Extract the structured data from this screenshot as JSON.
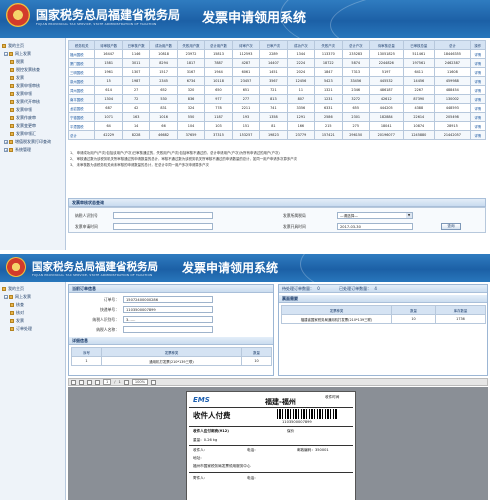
{
  "shot1": {
    "banner": {
      "title_cn": "国家税务总局福建省税务局",
      "title_en": "FUJIAN PROVINCIAL TAX SERVICE, STATE ADMINISTRATION OF TAXATION",
      "system": "发票申请领用系统"
    },
    "tree": [
      "我的主页",
      "网上发票",
      "税票",
      "税控发票核查",
      "发票",
      "发票申领审核",
      "发票申领",
      "发票代开审核",
      "发票申领",
      "发票作废审",
      "发票变更审",
      "发票申领汇",
      "增值税发票打印查询",
      "系统管理"
    ],
    "table": {
      "headers": [
        "税务机关",
        "待审核户数",
        "已审核户数",
        "成功用户数",
        "失败用户数",
        "总计用户数",
        "待审户次",
        "已审户次",
        "成功户次",
        "失败户次",
        "总计户次",
        "待审核总量",
        "已审核总量",
        "总计",
        "操作"
      ],
      "rows": [
        [
          "福州国税",
          "16447",
          "1146",
          "10818",
          "23972",
          "15813",
          "112593",
          "2289",
          "1344",
          "113370",
          "235283",
          "13051825",
          "511461",
          "18446355",
          "详情"
        ],
        [
          "厦门国税",
          "1581",
          "3011",
          "8294",
          "1817",
          "7887",
          "4287",
          "14407",
          "2224",
          "18722",
          "5874",
          "2244826",
          "197561",
          "2462387",
          "详情"
        ],
        [
          "三明国税",
          "1961",
          "1307",
          "1517",
          "3167",
          "1944",
          "6061",
          "1451",
          "2024",
          "1847",
          "7313",
          "5197",
          "6411",
          "11608",
          "详情"
        ],
        [
          "泉州国税",
          "15",
          "1987",
          "2345",
          "6734",
          "10118",
          "23457",
          "3567",
          "12456",
          "5423",
          "33456",
          "445532",
          "14456",
          "459988",
          "详情"
        ],
        [
          "漳州国税",
          "614",
          "27",
          "652",
          "320",
          "650",
          "651",
          "721",
          "11",
          "1321",
          "2346",
          "486187",
          "2267",
          "488454",
          "详情"
        ],
        [
          "南平国税",
          "1304",
          "72",
          "530",
          "836",
          "977",
          "277",
          "813",
          "807",
          "1231",
          "3272",
          "42612",
          "87390",
          "130002",
          "详情"
        ],
        [
          "龙岩国税",
          "687",
          "42",
          "831",
          "324",
          "778",
          "2211",
          "741",
          "3356",
          "6331",
          "655",
          "444205",
          "4388",
          "448593",
          "详情"
        ],
        [
          "宁德国税",
          "1071",
          "163",
          "1016",
          "550",
          "1187",
          "193",
          "1358",
          "1291",
          "2586",
          "2301",
          "182884",
          "22614",
          "205498",
          "详情"
        ],
        [
          "平潭国税",
          "64",
          "14",
          "66",
          "104",
          "103",
          "151",
          "81",
          "166",
          "215",
          "275",
          "18041",
          "10874",
          "28915",
          "详情"
        ],
        [
          "总计",
          "42229",
          "8228",
          "46682",
          "37659",
          "37315",
          "153257",
          "19823",
          "23779",
          "157421",
          "296150",
          "20196077",
          "1245880",
          "21442057",
          "详情"
        ]
      ]
    },
    "notes": [
      "1、 申请成功用户(户次)包括该用户(户次)已审核通过的，失败用户(户次)包括审核不通过的，总计申请用户(户次)为所有申请过的用户(户次)",
      "2、 审核通过数为该税务机关所审核通过的申请数量的总计，审核不通过数为该税务机关所审核不通过的申请数量的总计，如同一用户申请多次算多户次",
      "3、 未审核数为该税务机关尚未审核的申请数量的总计，在总计中同一用户多次申请算多户次"
    ],
    "query": {
      "title": "发票审核状态查询",
      "fields": [
        {
          "label": "纳税人识别号",
          "value": ""
        },
        {
          "label": "发票申请时间",
          "value": ""
        },
        {
          "label": "发票所属税局",
          "value": "—请选择—"
        },
        {
          "label": "发票开具时间",
          "value": "2017-03-30"
        }
      ],
      "search_label": "查询"
    }
  },
  "shot2": {
    "banner": {
      "title_cn": "国家税务总局福建省税务局",
      "title_en": "FUJIAN PROVINCIAL TAX SERVICE, STATE ADMINISTRATION OF TAXATION",
      "system": "发票申请领用系统"
    },
    "tree": [
      "我的主页",
      "网上发票",
      "核查",
      "核对",
      "发票",
      "订单处理"
    ],
    "order": {
      "title": "当前订单信息",
      "fields": [
        {
          "label": "订单号：",
          "value": "15072400000286"
        },
        {
          "label": "快递单号：",
          "value": "1103500007899"
        },
        {
          "label": "纳税人识别号：",
          "value": "3……"
        },
        {
          "label": "纳税人名称：",
          "value": ""
        }
      ],
      "details_title": "详细信息",
      "details_headers": [
        "序号",
        "发票种类",
        "数量"
      ],
      "details_rows": [
        [
          "1",
          "通用机打发票(210*139三联)",
          "10"
        ]
      ]
    },
    "pending": {
      "label": "待处理订单数量：",
      "value": "0",
      "done_label": "已处理订单数量：",
      "done_value": "4"
    },
    "summary": {
      "title": "票面需要",
      "headers": [
        "发票种类",
        "数量",
        "库存数量"
      ],
      "rows": [
        [
          "福建省国家税务局通用机打发票(210*139三联)",
          "10",
          "1736"
        ]
      ]
    },
    "viewer": {
      "page": "1",
      "pages": "1",
      "zoom": "100%"
    },
    "label": {
      "ems": "EMS",
      "route": "福建-福州",
      "receipt": "收件时间",
      "pay": "收件人付费",
      "tracking": "1103500007899",
      "payable": "收件人应付邮资(¥12)",
      "insured": "保价",
      "weight": "重量：0.26 kg",
      "receiver": "收件人：",
      "phone": "电话：",
      "postcode": "邮政编码：350001",
      "address": "地址：",
      "org": "福州市国家税务局发票领用服务中心",
      "sender": "寄件人：",
      "sender_phone": "电话："
    }
  }
}
